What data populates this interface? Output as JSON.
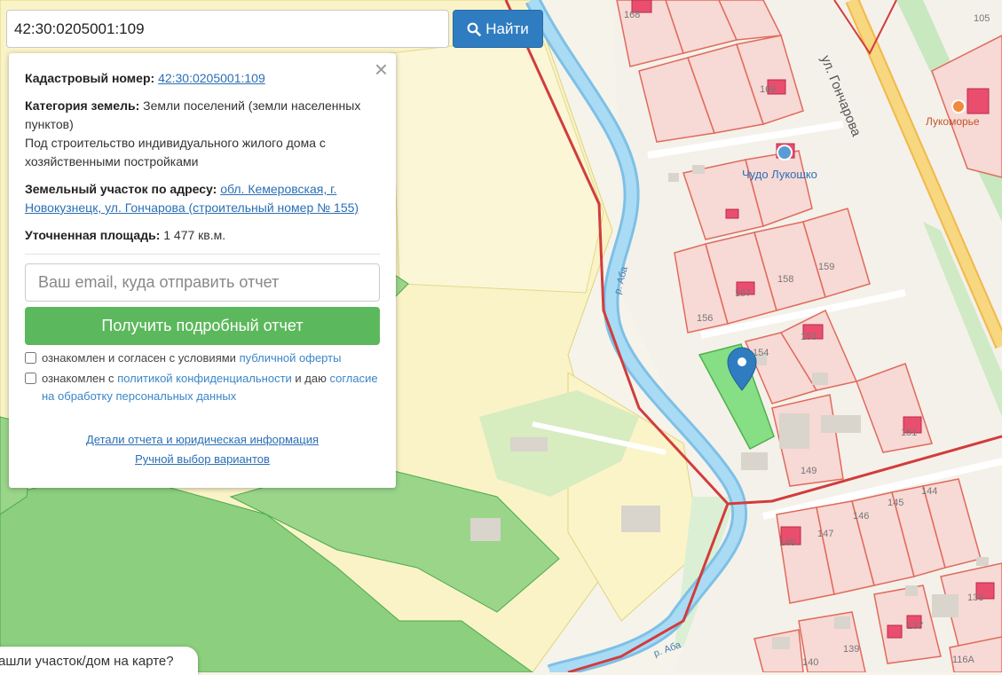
{
  "search": {
    "value": "42:30:0205001:109",
    "button_label": "Найти"
  },
  "panel": {
    "cadastral_label": "Кадастровый номер:",
    "cadastral_value": "42:30:0205001:109",
    "category_label": "Категория земель:",
    "category_value": "Земли поселений (земли населенных пунктов)",
    "usage_text": "Под строительство индивидуального жилого дома с хозяйственными постройками",
    "address_label": "Земельный участок по адресу:",
    "address_value": "обл. Кемеровская, г. Новокузнецк, ул. Гончарова (строительный номер № 155)",
    "area_label": "Уточненная площадь:",
    "area_value": "1 477 кв.м.",
    "email_placeholder": "Ваш email, куда отправить отчет",
    "report_button": "Получить подробный отчет",
    "consent1_text": "ознакомлен и согласен с условиями ",
    "consent1_link": "публичной оферты",
    "consent2_text": "ознакомлен с ",
    "consent2_link": "политикой конфиденциальности",
    "consent2_text2": " и даю ",
    "consent2_link2": "согласие на обработку персональных данных",
    "details_link": "Детали отчета и юридическая информация",
    "manual_link": "Ручной выбор вариантов"
  },
  "bottom_bar": "ашли участок/дом на карте?",
  "map": {
    "street": "ул. Гончарова",
    "river1": "р. Аба",
    "river2": "р. Аба",
    "poi1": "Чудо Лукошко",
    "poi2": "Лукоморье",
    "lots": [
      "168",
      "169",
      "105",
      "159",
      "158",
      "157",
      "156",
      "154",
      "153",
      "151",
      "149",
      "148",
      "147",
      "146",
      "145",
      "144",
      "140",
      "139",
      "137",
      "133",
      "116А"
    ]
  },
  "colors": {
    "accent_blue": "#2f7dc0",
    "report_green": "#5cb85c",
    "parcel_red": "#e04b4b",
    "selected_parcel": "#7bdc7b"
  }
}
